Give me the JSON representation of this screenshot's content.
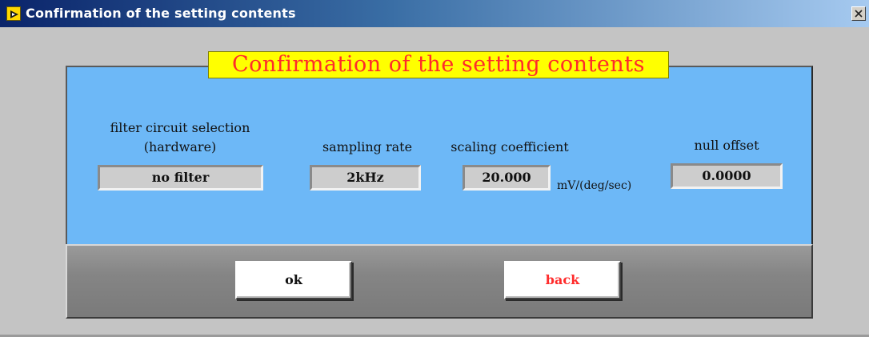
{
  "window": {
    "title": "Confirmation of the setting contents"
  },
  "panel": {
    "heading": "Confirmation of the setting contents",
    "filter": {
      "label_line1": "filter circuit selection",
      "label_line2": "(hardware)",
      "value": "no filter"
    },
    "sampling": {
      "label": "sampling rate",
      "value": "2kHz"
    },
    "scaling": {
      "label": "scaling coefficient",
      "value": "20.000",
      "unit": "mV/(deg/sec)"
    },
    "null_offset": {
      "label": "null offset",
      "value": "0.0000"
    }
  },
  "buttons": {
    "ok": "ok",
    "back": "back"
  },
  "colors": {
    "panel_bg": "#6db8f7",
    "heading_bg": "#ffff00",
    "heading_text": "#ff2b2b",
    "back_text": "#ff2b2b"
  },
  "icons": {
    "app": "labview-run-icon",
    "close": "close-icon"
  }
}
